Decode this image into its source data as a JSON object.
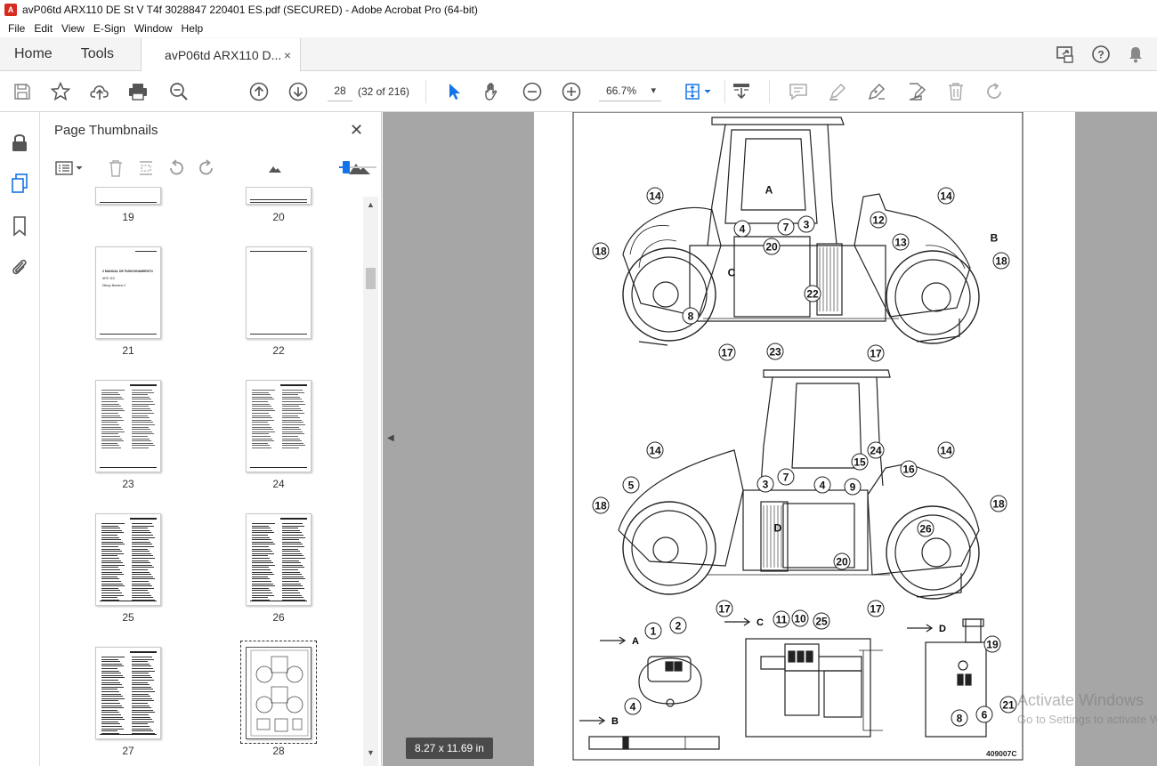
{
  "window": {
    "title": "avP06td ARX110 DE St V T4f 3028847 220401 ES.pdf (SECURED) - Adobe Acrobat Pro (64-bit)"
  },
  "menu": [
    "File",
    "Edit",
    "View",
    "E-Sign",
    "Window",
    "Help"
  ],
  "tabs": {
    "home": "Home",
    "tools": "Tools",
    "document": "avP06td ARX110 D...",
    "close": "×"
  },
  "toolbar": {
    "page_number": "28",
    "page_count": "(32 of 216)",
    "zoom": "66.7%",
    "zoom_arrow": "▾"
  },
  "thumbnails_panel": {
    "title": "Page Thumbnails",
    "close": "✕",
    "thumbnail_size_fraction": 0.2,
    "pages": [
      {
        "label": "19"
      },
      {
        "label": "20"
      },
      {
        "label": "21",
        "lines": [
          "2 MANUAL DE FUNCIONAMIENTO",
          "ARX 110",
          "Dibujo Baviera C"
        ]
      },
      {
        "label": "22"
      },
      {
        "label": "23"
      },
      {
        "label": "24"
      },
      {
        "label": "25"
      },
      {
        "label": "26"
      },
      {
        "label": "27"
      },
      {
        "label": "28"
      }
    ]
  },
  "document": {
    "page_size": "8.27 x 11.69 in",
    "figure_code": "409007C",
    "view_letters": [
      "A",
      "B",
      "C",
      "D"
    ],
    "callouts_top": [
      "14",
      "14",
      "4",
      "7",
      "3",
      "12",
      "20",
      "13",
      "18",
      "18",
      "C",
      "22",
      "8",
      "17",
      "23",
      "17",
      "B",
      "A"
    ],
    "callouts_middle": [
      "14",
      "14",
      "5",
      "3",
      "7",
      "4",
      "24",
      "15",
      "16",
      "9",
      "18",
      "18",
      "D",
      "20",
      "26",
      "17",
      "17"
    ],
    "callouts_bottom": [
      "1",
      "2",
      "4",
      "11",
      "10",
      "25",
      "19",
      "8",
      "6",
      "21"
    ]
  },
  "watermark": {
    "line1": "Activate Windows",
    "line2": "Go to Settings to activate Windows."
  }
}
